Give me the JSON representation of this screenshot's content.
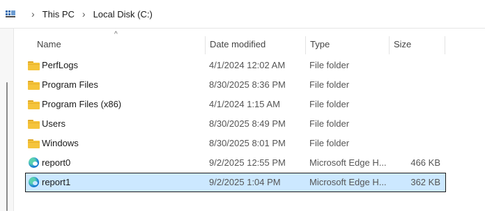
{
  "breadcrumb": {
    "items": [
      "This PC",
      "Local Disk (C:)"
    ],
    "icon": "this-pc-icon",
    "separator_icon": "chevron-right-icon"
  },
  "header": {
    "name": "Name",
    "date_modified": "Date modified",
    "type": "Type",
    "size": "Size",
    "sort_indicator": "^"
  },
  "files": [
    {
      "name": "PerfLogs",
      "date": "4/1/2024 12:02 AM",
      "type": "File folder",
      "size": "",
      "icon": "folder-icon"
    },
    {
      "name": "Program Files",
      "date": "8/30/2025 8:36 PM",
      "type": "File folder",
      "size": "",
      "icon": "folder-icon"
    },
    {
      "name": "Program Files (x86)",
      "date": "4/1/2024 1:15 AM",
      "type": "File folder",
      "size": "",
      "icon": "folder-icon"
    },
    {
      "name": "Users",
      "date": "8/30/2025 8:49 PM",
      "type": "File folder",
      "size": "",
      "icon": "folder-icon"
    },
    {
      "name": "Windows",
      "date": "8/30/2025 8:01 PM",
      "type": "File folder",
      "size": "",
      "icon": "folder-icon"
    },
    {
      "name": "report0",
      "date": "9/2/2025 12:55 PM",
      "type": "Microsoft Edge H...",
      "size": "466 KB",
      "icon": "edge-html-icon"
    },
    {
      "name": "report1",
      "date": "9/2/2025 1:04 PM",
      "type": "Microsoft Edge H...",
      "size": "362 KB",
      "icon": "edge-html-icon",
      "selected": true
    }
  ],
  "colors": {
    "selection": "#cce8ff",
    "folder": "#f5c43b",
    "edge": "#1b83d6"
  }
}
